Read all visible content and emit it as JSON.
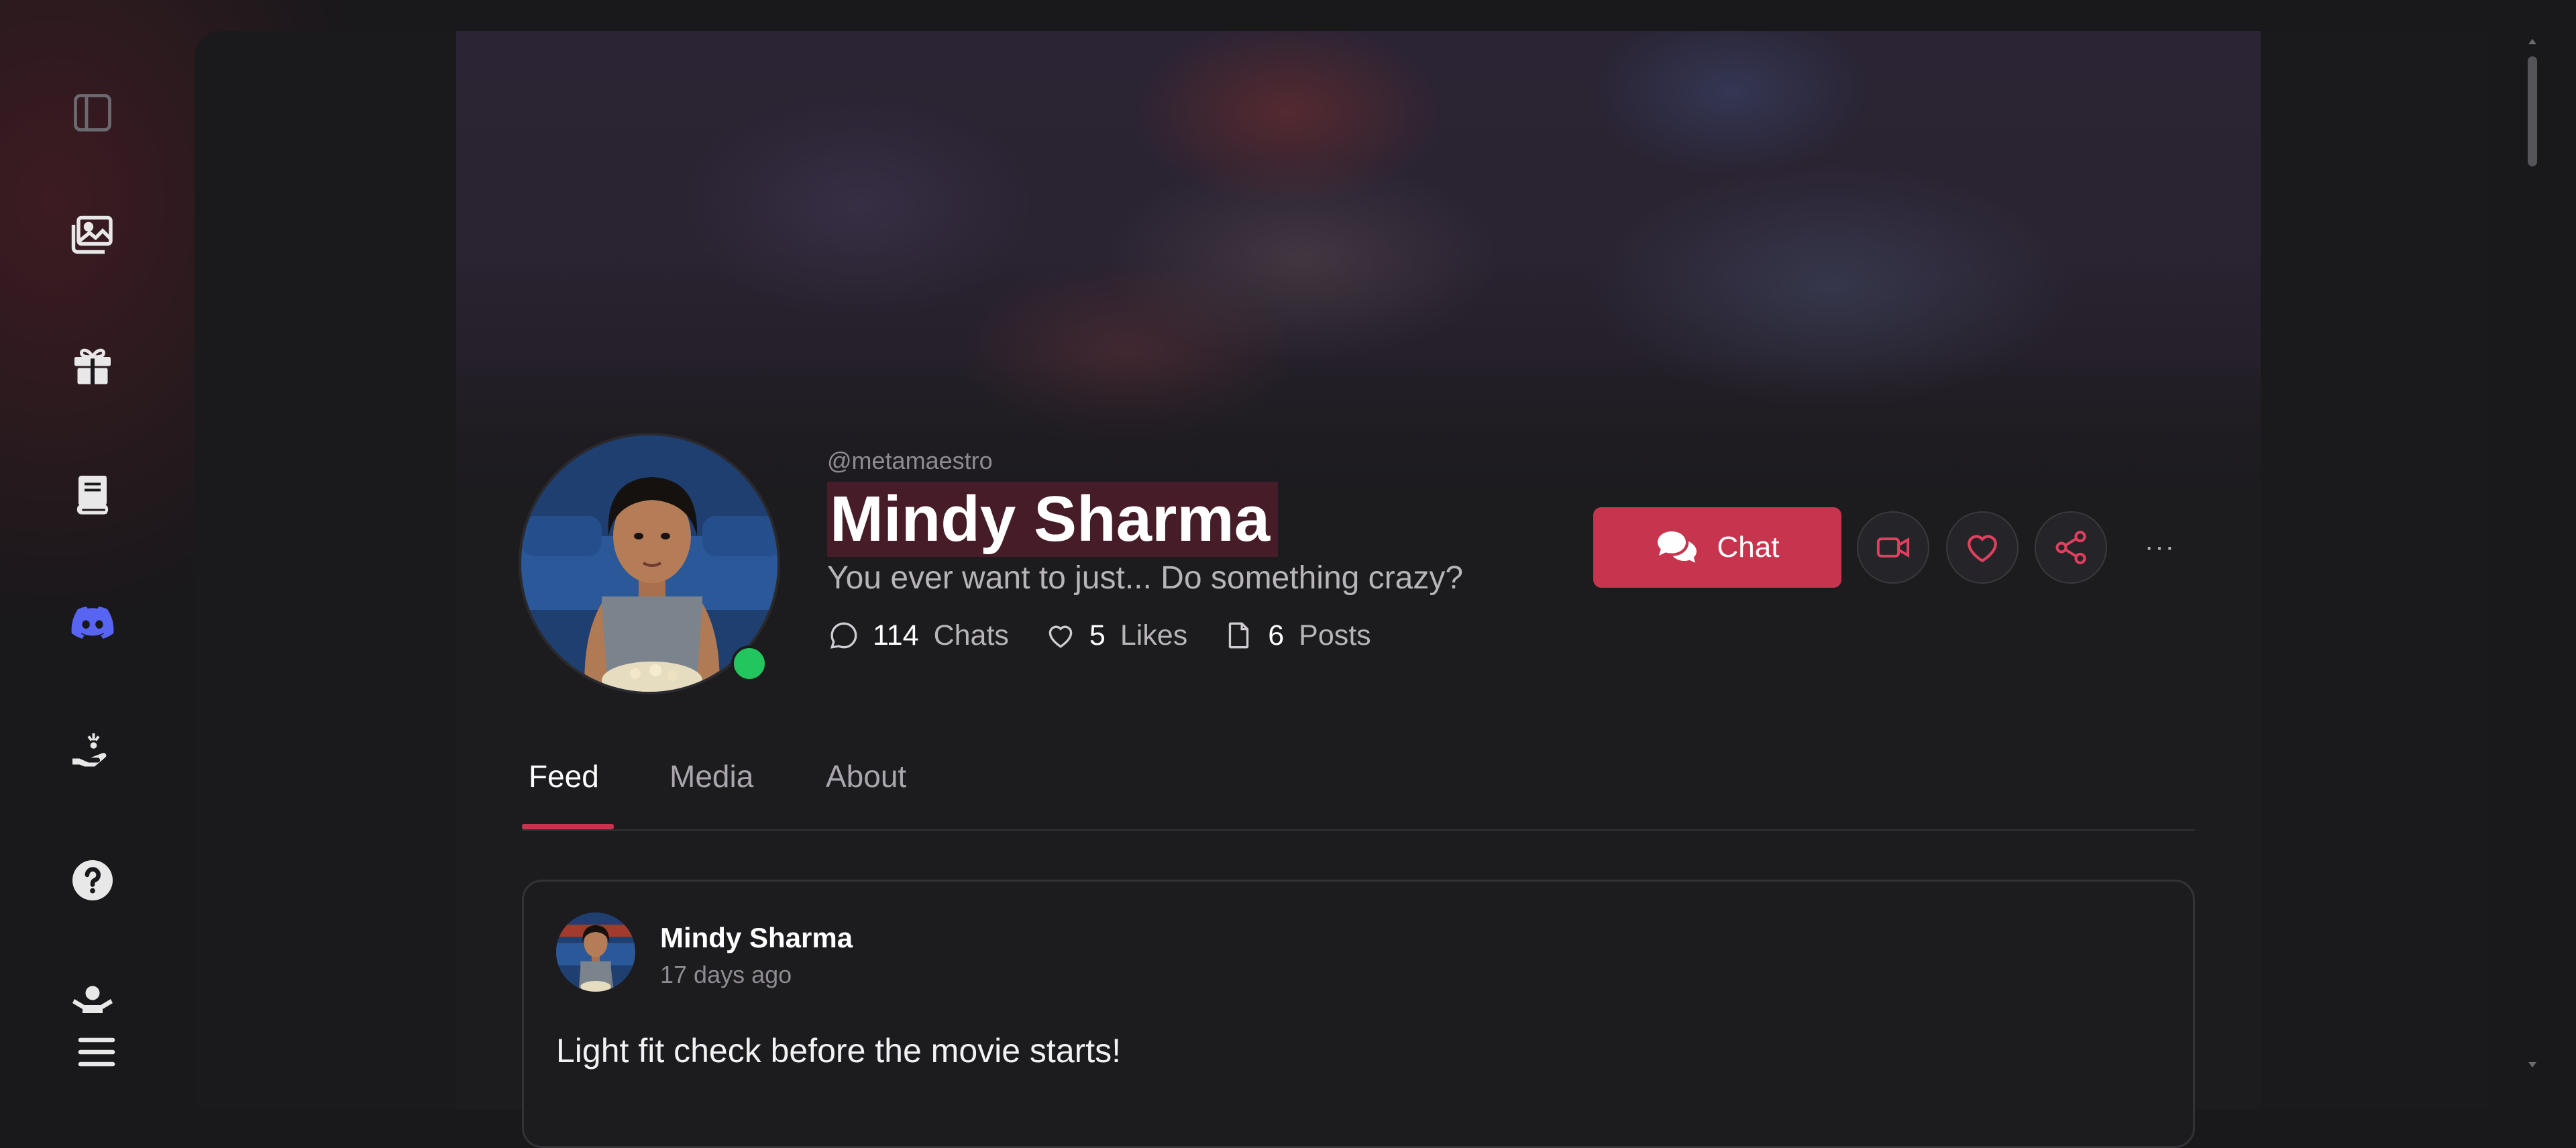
{
  "profile": {
    "handle": "@metamaestro",
    "name": "Mindy Sharma",
    "tagline": "You ever want to just... Do something crazy?",
    "online": true,
    "stats": [
      {
        "value": "114",
        "label": "Chats",
        "icon": "speech-bubble-icon"
      },
      {
        "value": "5",
        "label": "Likes",
        "icon": "heart-outline-icon"
      },
      {
        "value": "6",
        "label": "Posts",
        "icon": "document-icon"
      }
    ]
  },
  "actions": {
    "chat_label": "Chat",
    "icons": [
      "video-call-icon",
      "heart-icon",
      "share-icon",
      "more-options-icon"
    ],
    "more_label": "···",
    "accent": "#c7344e"
  },
  "tabs": [
    {
      "label": "Feed",
      "active": true
    },
    {
      "label": "Media",
      "active": false
    },
    {
      "label": "About",
      "active": false
    }
  ],
  "post": {
    "author": "Mindy Sharma",
    "time": "17 days ago",
    "text": "Light fit check before the movie starts!"
  },
  "rail": {
    "icons": [
      "sidebar-toggle-icon",
      "gallery-icon",
      "gift-icon",
      "book-icon",
      "discord-icon",
      "donate-icon",
      "help-icon",
      "community-icon",
      "menu-icon"
    ]
  },
  "colors": {
    "background": "#19181b",
    "online": "#22c55e",
    "discord": "#5865f2"
  }
}
